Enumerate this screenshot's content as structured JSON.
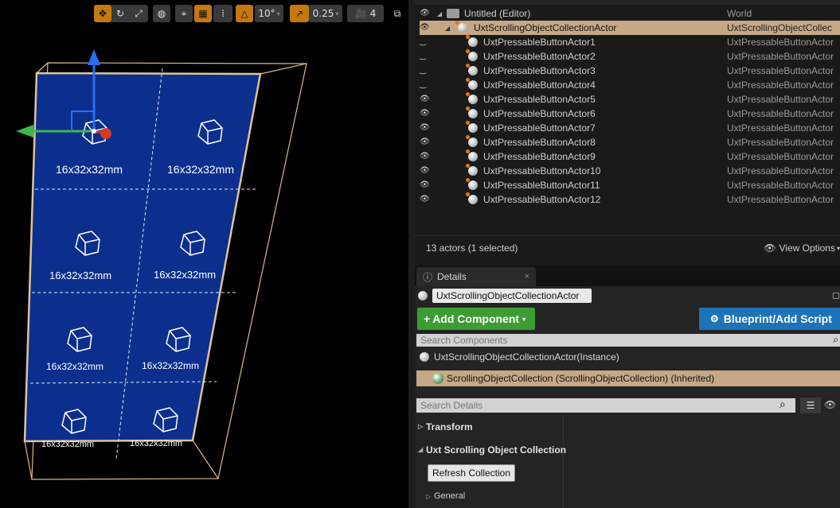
{
  "viewport": {
    "toolbar": {
      "grid_snap_value": "10°",
      "scale_snap_value": "0.25",
      "camera_speed": "4"
    },
    "cells": [
      {
        "label": "16x32x32mm"
      },
      {
        "label": "16x32x32mm"
      },
      {
        "label": "16x32x32mm"
      },
      {
        "label": "16x32x32mm"
      },
      {
        "label": "16x32x32mm"
      },
      {
        "label": "16x32x32mm"
      },
      {
        "label": "16x32x32mm"
      },
      {
        "label": "16x32x32mm"
      }
    ],
    "colors": {
      "panel": "#0c2f8e",
      "frame": "#d8b98e",
      "gizmo_z": "#2a6ef0",
      "gizmo_y": "#39b94a",
      "gizmo_x": "#d23c2c"
    }
  },
  "outliner": {
    "rows": [
      {
        "label": "Untitled (Editor)",
        "type": "World"
      },
      {
        "label": "UxtScrollingObjectCollectionActor",
        "type": "UxtScrollingObjectCollec"
      },
      {
        "label": "UxtPressableButtonActor1",
        "type": "UxtPressableButtonActor"
      },
      {
        "label": "UxtPressableButtonActor2",
        "type": "UxtPressableButtonActor"
      },
      {
        "label": "UxtPressableButtonActor3",
        "type": "UxtPressableButtonActor"
      },
      {
        "label": "UxtPressableButtonActor4",
        "type": "UxtPressableButtonActor"
      },
      {
        "label": "UxtPressableButtonActor5",
        "type": "UxtPressableButtonActor"
      },
      {
        "label": "UxtPressableButtonActor6",
        "type": "UxtPressableButtonActor"
      },
      {
        "label": "UxtPressableButtonActor7",
        "type": "UxtPressableButtonActor"
      },
      {
        "label": "UxtPressableButtonActor8",
        "type": "UxtPressableButtonActor"
      },
      {
        "label": "UxtPressableButtonActor9",
        "type": "UxtPressableButtonActor"
      },
      {
        "label": "UxtPressableButtonActor10",
        "type": "UxtPressableButtonActor"
      },
      {
        "label": "UxtPressableButtonActor11",
        "type": "UxtPressableButtonActor"
      },
      {
        "label": "UxtPressableButtonActor12",
        "type": "UxtPressableButtonActor"
      }
    ],
    "status": "13 actors (1 selected)",
    "view_options": "View Options"
  },
  "details": {
    "tab_label": "Details",
    "actor_name": "UxtScrollingObjectCollectionActor",
    "add_component": "Add Component",
    "blueprint_script": "Blueprint/Add Script",
    "search_components_placeholder": "Search Components",
    "instance_label": "UxtScrollingObjectCollectionActor(Instance)",
    "component_label": "ScrollingObjectCollection (ScrollingObjectCollection) (Inherited)",
    "search_details_placeholder": "Search Details",
    "category_transform": "Transform",
    "category_uxt": "Uxt Scrolling Object Collection",
    "refresh_button": "Refresh Collection",
    "category_general": "General"
  }
}
